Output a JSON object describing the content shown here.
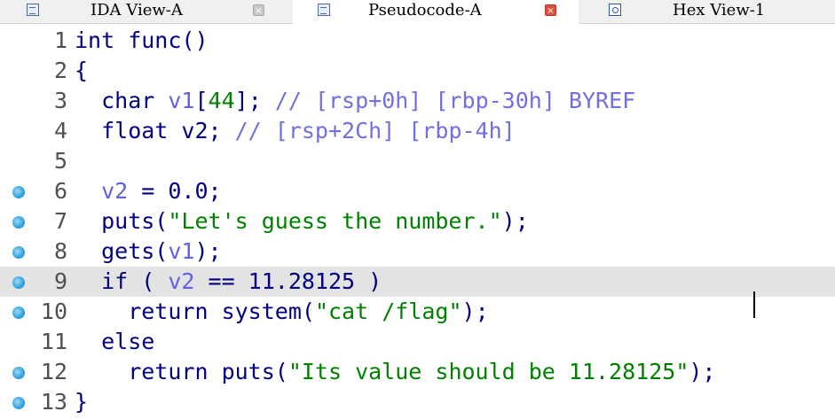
{
  "tabs": [
    {
      "label": "IDA View-A",
      "icon": "document-icon",
      "close": "×",
      "active": false
    },
    {
      "label": "Pseudocode-A",
      "icon": "document-icon",
      "close": "×",
      "active": true
    },
    {
      "label": "Hex View-1",
      "icon": "hex-icon",
      "close": "",
      "active": false
    }
  ],
  "colors": {
    "keyword": "#000080",
    "variable": "#6060e0",
    "number": "#008000",
    "string": "#008000",
    "comment": "#7070e0",
    "line_highlight": "#e3e3e3",
    "breakpoint": "#2f9fe0"
  },
  "code": {
    "line_numbers": [
      "1",
      "2",
      "3",
      "4",
      "5",
      "6",
      "7",
      "8",
      "9",
      "10",
      "11",
      "12",
      "13"
    ],
    "lines": [
      {
        "tokens": [
          {
            "t": "int func()",
            "c": "kw"
          }
        ]
      },
      {
        "tokens": [
          {
            "t": "{",
            "c": "kw"
          }
        ]
      },
      {
        "tokens": [
          {
            "t": "  char ",
            "c": "kw"
          },
          {
            "t": "v1",
            "c": "var"
          },
          {
            "t": "[",
            "c": "kw"
          },
          {
            "t": "44",
            "c": "num"
          },
          {
            "t": "]; ",
            "c": "kw"
          },
          {
            "t": "// [rsp+0h] [rbp-30h] BYREF",
            "c": "cm"
          }
        ]
      },
      {
        "tokens": [
          {
            "t": "  float v2; ",
            "c": "kw"
          },
          {
            "t": "// [rsp+2Ch] [rbp-4h]",
            "c": "cm"
          }
        ]
      },
      {
        "tokens": [
          {
            "t": "",
            "c": "kw"
          }
        ]
      },
      {
        "tokens": [
          {
            "t": "  ",
            "c": "kw"
          },
          {
            "t": "v2",
            "c": "var"
          },
          {
            "t": " = 0.0;",
            "c": "kw"
          }
        ]
      },
      {
        "tokens": [
          {
            "t": "  puts(",
            "c": "kw"
          },
          {
            "t": "\"Let's guess the number.\"",
            "c": "str"
          },
          {
            "t": ");",
            "c": "kw"
          }
        ]
      },
      {
        "tokens": [
          {
            "t": "  gets(",
            "c": "kw"
          },
          {
            "t": "v1",
            "c": "var"
          },
          {
            "t": ");",
            "c": "kw"
          }
        ]
      },
      {
        "tokens": [
          {
            "t": "  if ( ",
            "c": "kw"
          },
          {
            "t": "v2",
            "c": "var"
          },
          {
            "t": " == 11.28125 )",
            "c": "kw"
          }
        ]
      },
      {
        "tokens": [
          {
            "t": "    return system(",
            "c": "kw"
          },
          {
            "t": "\"cat /flag\"",
            "c": "str"
          },
          {
            "t": ");",
            "c": "kw"
          }
        ]
      },
      {
        "tokens": [
          {
            "t": "  else",
            "c": "kw"
          }
        ]
      },
      {
        "tokens": [
          {
            "t": "    return puts(",
            "c": "kw"
          },
          {
            "t": "\"Its value should be 11.28125\"",
            "c": "str"
          },
          {
            "t": ");",
            "c": "kw"
          }
        ]
      },
      {
        "tokens": [
          {
            "t": "}",
            "c": "kw"
          }
        ]
      }
    ],
    "breakpoints": [
      "6",
      "7",
      "8",
      "9",
      "10",
      "12",
      "13"
    ],
    "highlighted_line": "9"
  }
}
